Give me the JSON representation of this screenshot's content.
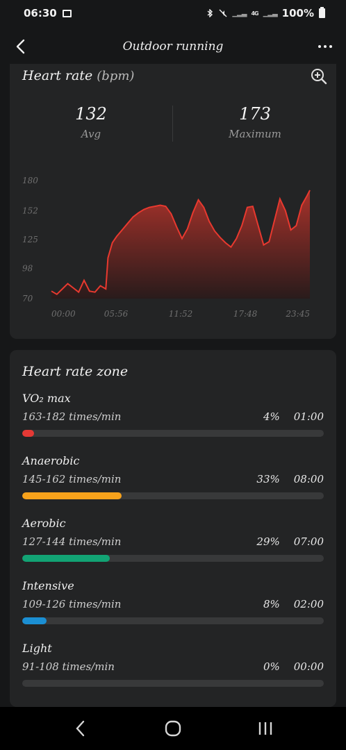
{
  "status": {
    "time": "06:30",
    "signal_text": "4G",
    "battery": "100%"
  },
  "header": {
    "title": "Outdoor running"
  },
  "heart_rate": {
    "title": "Heart rate",
    "unit": "(bpm)",
    "avg_value": "132",
    "avg_label": "Avg",
    "max_value": "173",
    "max_label": "Maximum"
  },
  "chart_data": {
    "type": "area",
    "title": "",
    "y_ticks": [
      "180",
      "152",
      "125",
      "98",
      "70"
    ],
    "x_ticks": [
      "00:00",
      "05:56",
      "11:52",
      "17:48",
      "23:45"
    ],
    "ylim": [
      70,
      180
    ],
    "xlim_minutes": [
      0,
      23.75
    ],
    "color": "#e8392f",
    "x": [
      0,
      0.5,
      1,
      1.5,
      2,
      2.5,
      3,
      3.5,
      4,
      4.5,
      5,
      5.2,
      5.6,
      6,
      6.5,
      7,
      7.5,
      8,
      8.5,
      9,
      9.5,
      10,
      10.5,
      11,
      11.5,
      12,
      12.5,
      13,
      13.5,
      14,
      14.5,
      15,
      15.5,
      16,
      16.5,
      17,
      17.5,
      18,
      18.5,
      19,
      19.5,
      20,
      20.5,
      21,
      21.5,
      22,
      22.5,
      23,
      23.5,
      23.75
    ],
    "y": [
      77,
      74,
      79,
      84,
      80,
      76,
      87,
      77,
      76,
      82,
      79,
      108,
      122,
      128,
      134,
      140,
      146,
      150,
      153,
      155,
      156,
      157,
      156,
      149,
      137,
      126,
      135,
      150,
      162,
      155,
      142,
      133,
      127,
      122,
      118,
      126,
      138,
      155,
      156,
      138,
      120,
      123,
      143,
      163,
      152,
      134,
      138,
      157,
      166,
      171
    ]
  },
  "zones_section": {
    "title": "Heart rate zone",
    "zones": [
      {
        "name": "VO₂ max",
        "range": "163-182 times/min",
        "percent": "4%",
        "duration": "01:00",
        "fraction": 0.04,
        "color": "#e53935"
      },
      {
        "name": "Anaerobic",
        "range": "145-162 times/min",
        "percent": "33%",
        "duration": "08:00",
        "fraction": 0.33,
        "color": "#f7a21b"
      },
      {
        "name": "Aerobic",
        "range": "127-144 times/min",
        "percent": "29%",
        "duration": "07:00",
        "fraction": 0.29,
        "color": "#12a374"
      },
      {
        "name": "Intensive",
        "range": "109-126 times/min",
        "percent": "8%",
        "duration": "02:00",
        "fraction": 0.08,
        "color": "#1b8fd3"
      },
      {
        "name": "Light",
        "range": "91-108 times/min",
        "percent": "0%",
        "duration": "00:00",
        "fraction": 0,
        "color": "#9e9e9e"
      }
    ]
  },
  "icons": {
    "back": "back-arrow-icon",
    "more": "more-dots-icon",
    "zoom": "zoom-in-icon",
    "nav_back": "nav-back-icon",
    "nav_home": "nav-home-icon",
    "nav_recents": "nav-recents-icon"
  }
}
